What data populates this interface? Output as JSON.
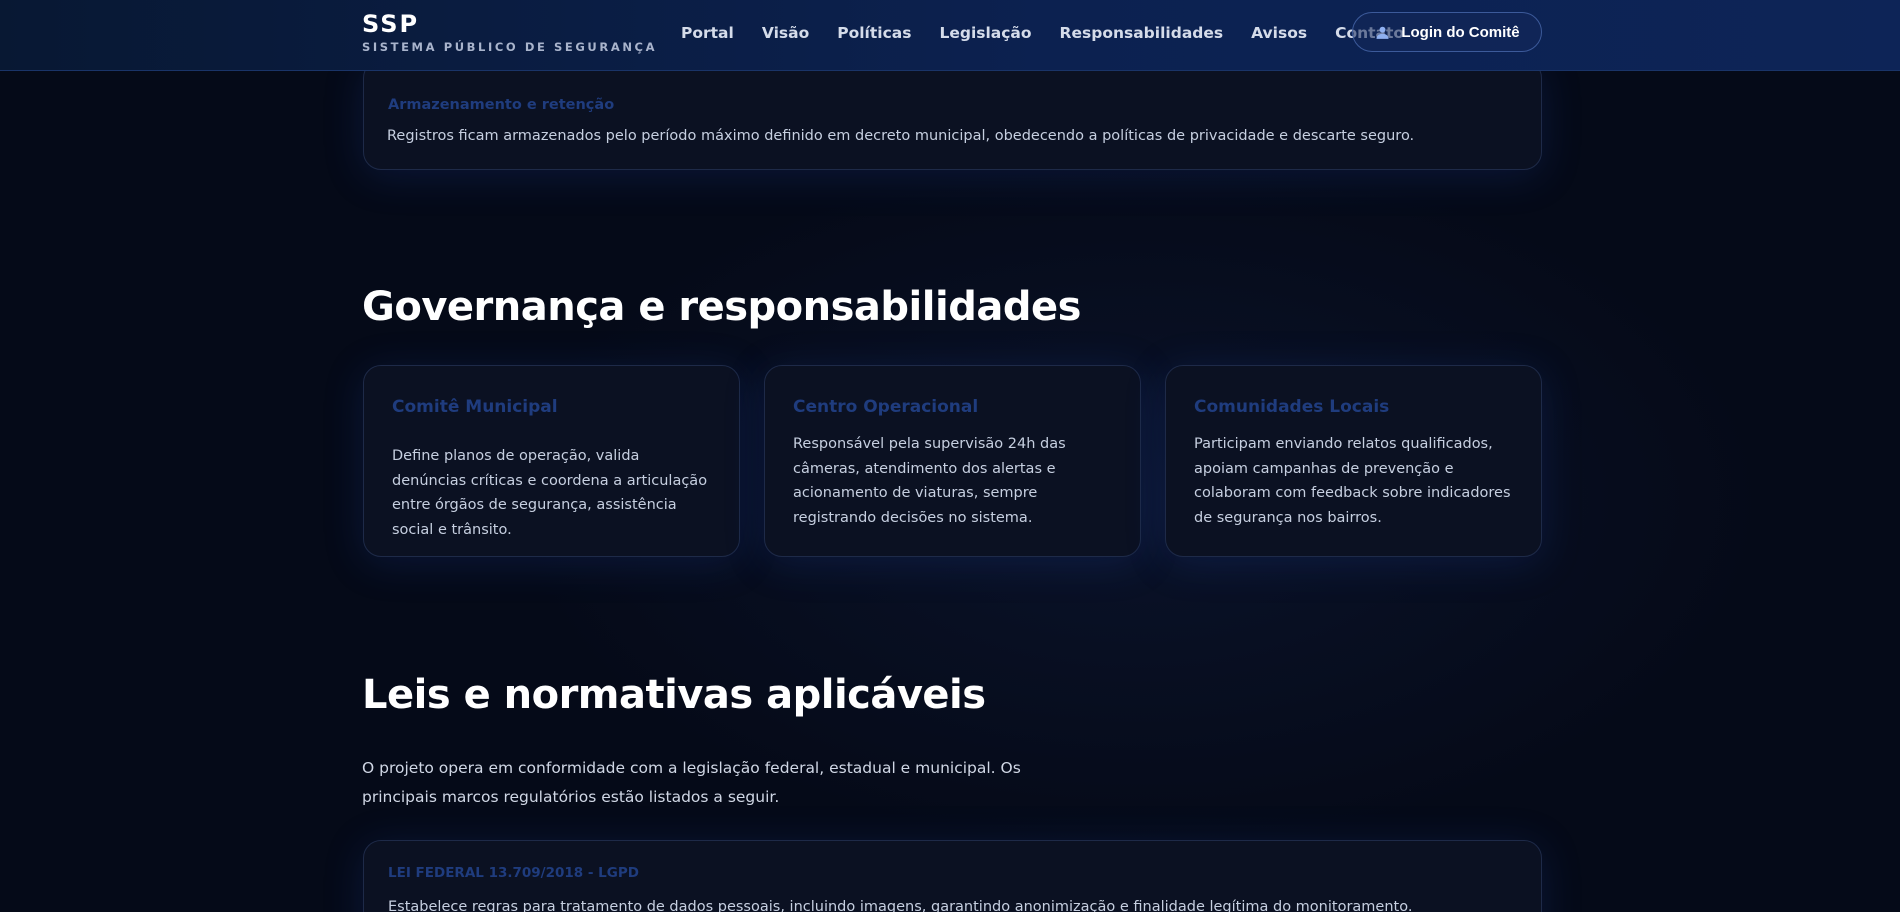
{
  "header": {
    "brand_title": "SSP",
    "brand_subtitle": "SISTEMA PÚBLICO DE SEGURANÇA",
    "nav": [
      "Portal",
      "Visão",
      "Políticas",
      "Legislação",
      "Responsabilidades",
      "Avisos",
      "Contato"
    ],
    "login_label": "Login do Comitê",
    "login_icon": "user-icon"
  },
  "storage": {
    "label": "Armazenamento e retenção",
    "text": "Registros ficam armazenados pelo período máximo definido em decreto municipal, obedecendo a políticas de privacidade e descarte seguro."
  },
  "governance": {
    "title": "Governança e responsabilidades",
    "cards": [
      {
        "label": "Comitê Municipal",
        "text": "Define planos de operação, valida denúncias críticas e coordena a articulação entre órgãos de segurança, assistência social e trânsito."
      },
      {
        "label": "Centro Operacional",
        "text": "Responsável pela supervisão 24h das câmeras, atendimento dos alertas e acionamento de viaturas, sempre registrando decisões no sistema."
      },
      {
        "label": "Comunidades Locais",
        "text": "Participam enviando relatos qualificados, apoiam campanhas de prevenção e colaboram com feedback sobre indicadores de segurança nos bairros."
      }
    ]
  },
  "laws": {
    "title": "Leis e normativas aplicáveis",
    "intro": "O projeto opera em conformidade com a legislação federal, estadual e municipal. Os principais marcos regulatórios estão listados a seguir.",
    "items": [
      {
        "label": "LEI FEDERAL 13.709/2018 - LGPD",
        "text": "Estabelece regras para tratamento de dados pessoais, incluindo imagens, garantindo anonimização e finalidade legítima do monitoramento."
      }
    ]
  },
  "colors": {
    "background": "#050a18",
    "header": "#0c2150",
    "card": "#0b1122",
    "card_label": "#1f3c7e",
    "heading": "#ffffff"
  }
}
